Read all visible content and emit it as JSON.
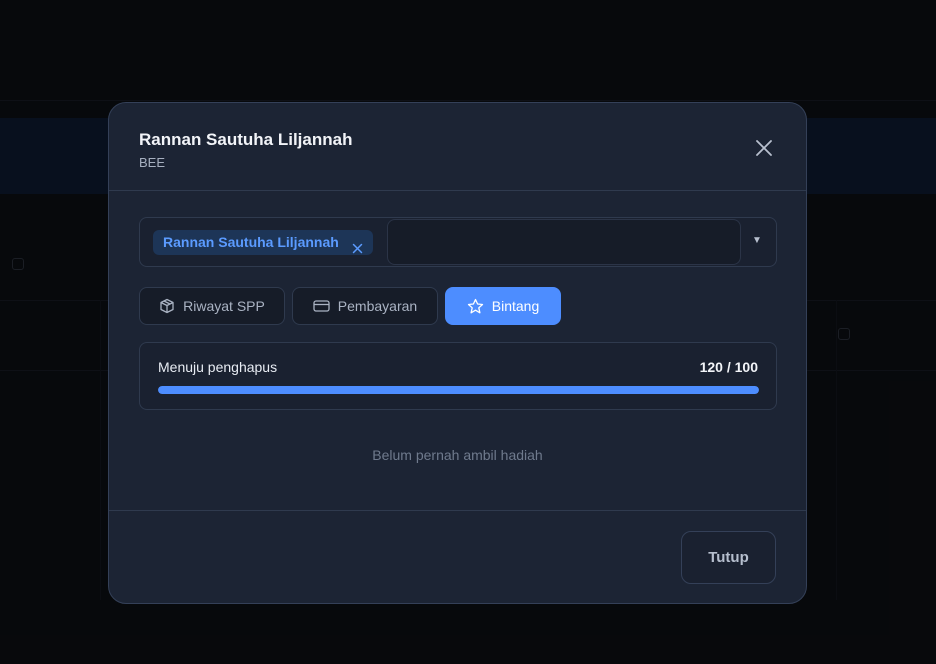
{
  "modal": {
    "title": "Rannan Sautuha Liljannah",
    "subtitle": "BEE"
  },
  "student_select": {
    "selected_chip": "Rannan Sautuha Liljannah",
    "search_value": "",
    "caret": "▼"
  },
  "tabs": [
    {
      "label": "Riwayat SPP",
      "icon": "box-icon",
      "active": false
    },
    {
      "label": "Pembayaran",
      "icon": "credit-card-icon",
      "active": false
    },
    {
      "label": "Bintang",
      "icon": "star-icon",
      "active": true
    }
  ],
  "progress": {
    "label": "Menuju penghapus",
    "value_text": "120 / 100",
    "current": 120,
    "target": 100
  },
  "empty_state": "Belum pernah ambil hadiah",
  "footer": {
    "close_label": "Tutup"
  },
  "colors": {
    "accent": "#4d8dff",
    "modal_bg": "#1c2434",
    "chip_bg": "#1d3557",
    "chip_text": "#5b9bff"
  }
}
